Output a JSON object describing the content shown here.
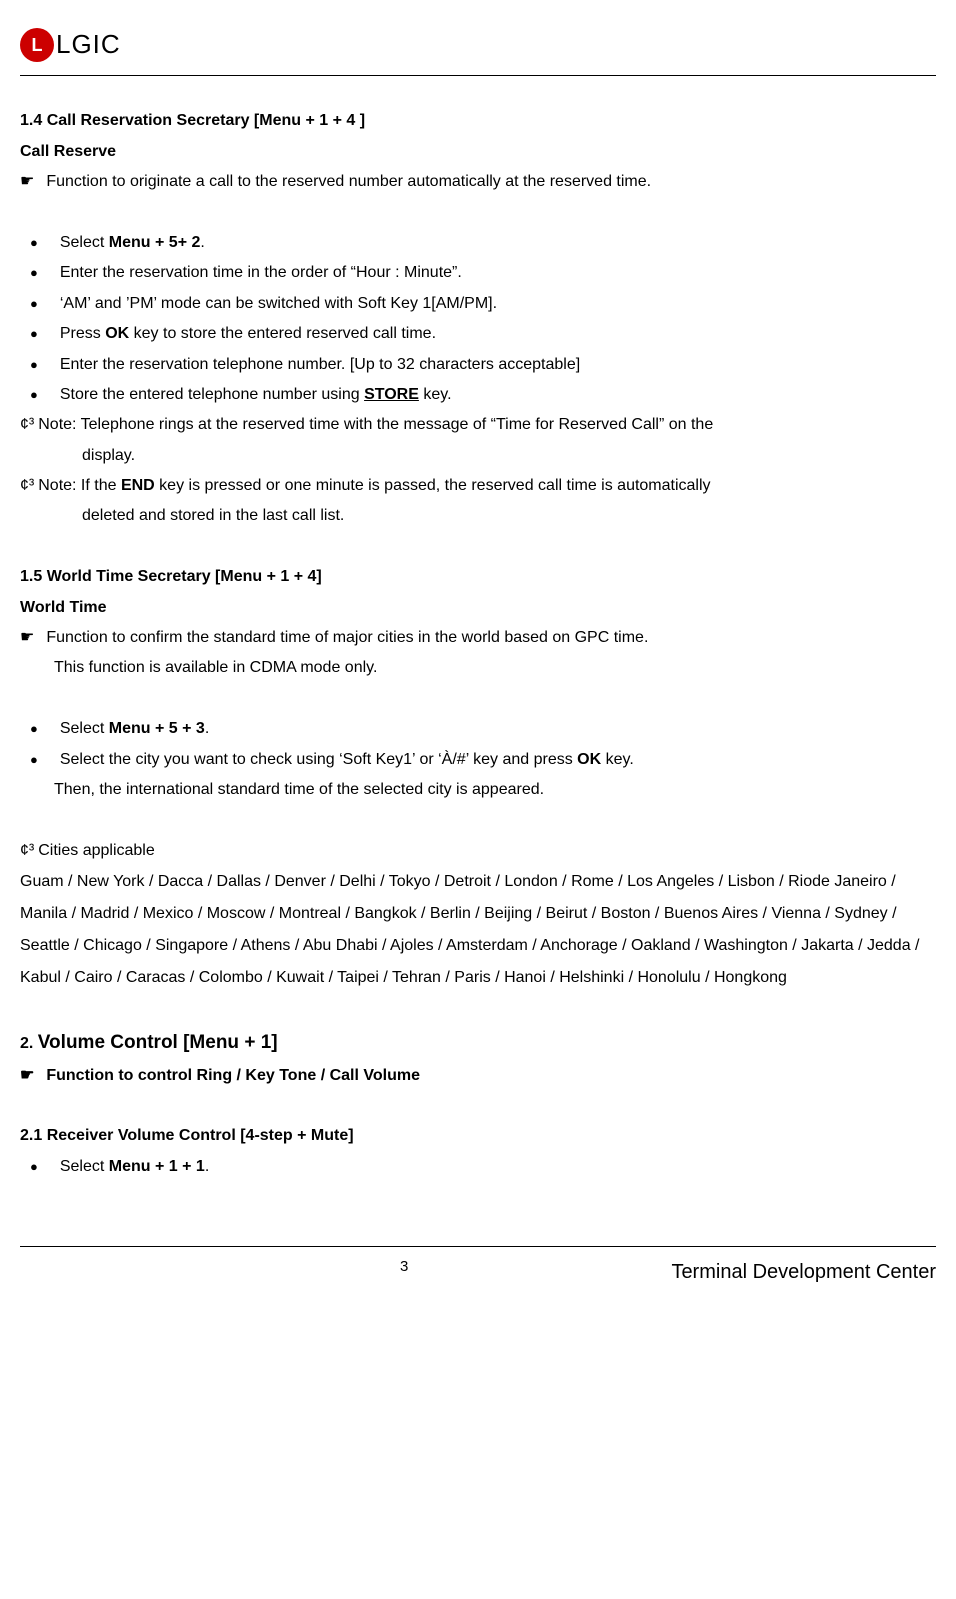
{
  "header": {
    "logo_l": "L",
    "logo_text": "LGIC"
  },
  "s14": {
    "heading": "1.4  Call Reservation Secretary [Menu + 1 + 4 ]",
    "subtitle": "Call Reserve",
    "desc": "Function to originate a call to the reserved number automatically at the reserved time.",
    "b1_pre": "Select ",
    "b1_bold": "Menu + 5+ 2",
    "b1_post": ".",
    "b2": "Enter the reservation time in the order of “Hour : Minute”.",
    "b3": "‘AM’ and ’PM’ mode can be switched with Soft Key 1[AM/PM].",
    "b4_pre": "Press ",
    "b4_bold": "OK",
    "b4_post": " key to store the entered reserved call time.",
    "b5": "Enter the reservation telephone number. [Up to 32 characters acceptable]",
    "b6_pre": "Store the entered telephone number using ",
    "b6_bold": "STORE",
    "b6_post": " key.",
    "note_sym": "¢³",
    "note1": "Note: Telephone rings at the reserved time with the message of “Time for Reserved Call” on the",
    "note1_cont": "display.",
    "note2_pre": "Note: If the ",
    "note2_bold": "END",
    "note2_post": " key is pressed or one minute is passed, the reserved call time is automatically",
    "note2_cont": "deleted and stored in the last call list."
  },
  "s15": {
    "heading": "1.5  World Time Secretary  [Menu + 1 + 4]",
    "subtitle": "World Time",
    "desc": "Function to confirm the standard time of major cities in the world based on GPC time.",
    "desc2": "This function is available in CDMA mode only.",
    "b1_pre": "Select ",
    "b1_bold": "Menu + 5 + 3",
    "b1_post": ".",
    "b2_pre": "Select the city you want to check using ‘Soft Key1’ or ‘À/#’ key and press ",
    "b2_bold": "OK",
    "b2_post": " key.",
    "b2_cont": "Then, the international standard time of the selected city is appeared.",
    "cities_label": "Cities applicable",
    "cities": "Guam / New York / Dacca / Dallas / Denver / Delhi / Tokyo / Detroit / London / Rome / Los Angeles / Lisbon / Riode Janeiro / Manila / Madrid / Mexico / Moscow / Montreal / Bangkok / Berlin / Beijing / Beirut / Boston / Buenos Aires / Vienna / Sydney / Seattle / Chicago / Singapore / Athens / Abu Dhabi / Ajoles / Amsterdam / Anchorage / Oakland / Washington / Jakarta / Jedda / Kabul / Cairo / Caracas / Colombo / Kuwait / Taipei / Tehran / Paris / Hanoi / Helshinki / Honolulu / Hongkong"
  },
  "s2": {
    "heading_pre": "2. ",
    "heading_main": "Volume Control [Menu + 1]",
    "desc": "Function to control Ring / Key Tone / Call Volume",
    "sub21": "2.1 Receiver Volume Control [4-step + Mute]",
    "b1_pre": "Select ",
    "b1_bold": "Menu + 1 + 1",
    "b1_post": "."
  },
  "footer": {
    "page": "3",
    "right": "Terminal Development Center"
  },
  "sym": {
    "pointer": "☛",
    "bullet": "●"
  }
}
